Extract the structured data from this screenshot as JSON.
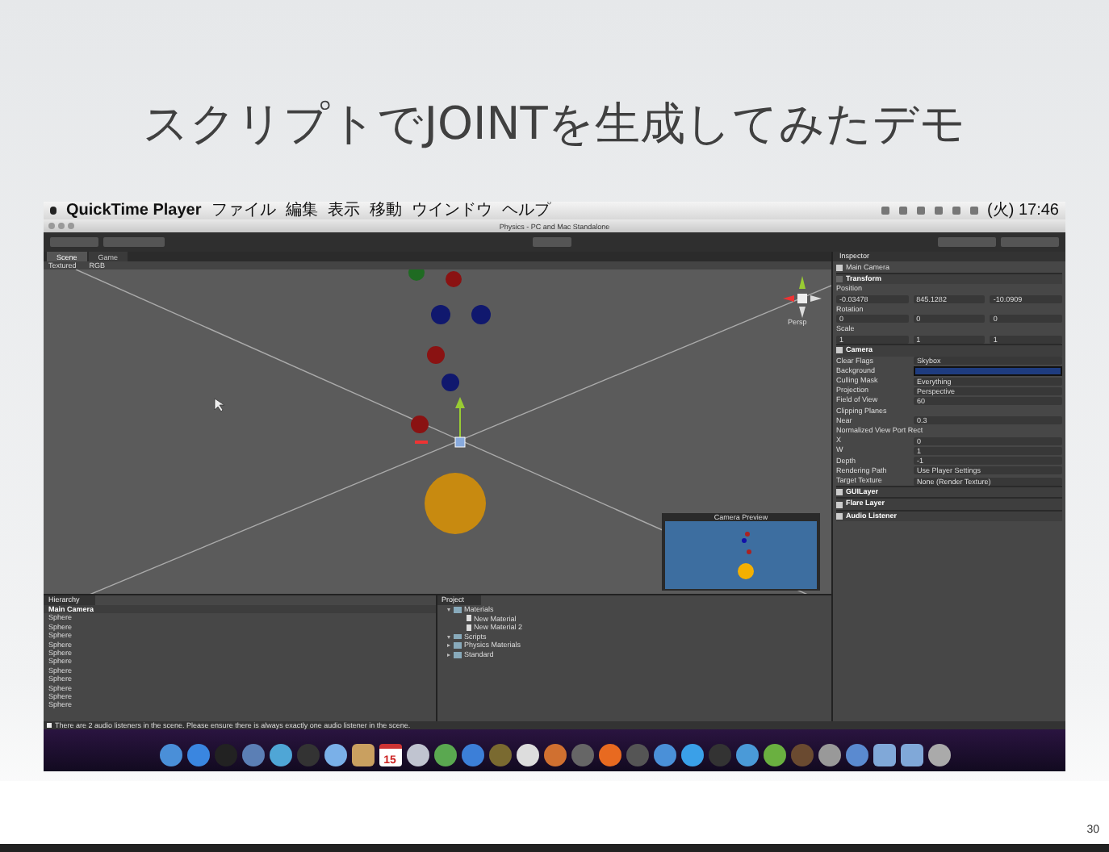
{
  "slide": {
    "title": "スクリプトでJOINTを生成してみたデモ",
    "page_number": "30"
  },
  "menu_bar": {
    "app": "QuickTime Player",
    "items": [
      "ファイル",
      "編集",
      "表示",
      "移動",
      "ウインドウ",
      "ヘルプ"
    ],
    "clock": "(火) 17:46"
  },
  "window": {
    "title": "Physics - PC and Mac Standalone"
  },
  "scene_tabs": [
    {
      "label": "Scene",
      "selected": true
    },
    {
      "label": "Game",
      "selected": false
    }
  ],
  "scene_toolbar": {
    "mode": "Textured",
    "channel": "RGB"
  },
  "scene": {
    "view_label": "Persp",
    "spheres": [
      {
        "color": "#1f6b22"
      },
      {
        "color": "#8a1212"
      },
      {
        "color": "#10186e"
      },
      {
        "color": "#10186e"
      },
      {
        "color": "#8a1212"
      },
      {
        "color": "#10186e"
      },
      {
        "color": "#8a1212"
      },
      {
        "color": "#c88a10"
      }
    ]
  },
  "camera_preview": {
    "title": "Camera Preview"
  },
  "inspector": {
    "title": "Inspector",
    "object": "Main Camera",
    "object_active": true,
    "rows": [
      {
        "kind": "component",
        "label": "Transform",
        "checked": false
      },
      {
        "kind": "section",
        "label": "Position"
      },
      {
        "kind": "vector",
        "values": [
          "-0.03478",
          "845.1282",
          "-10.0909"
        ]
      },
      {
        "kind": "section",
        "label": "Rotation"
      },
      {
        "kind": "vector",
        "values": [
          "0",
          "0",
          "0"
        ]
      },
      {
        "kind": "section",
        "label": "Scale"
      },
      {
        "kind": "vector",
        "values": [
          "1",
          "1",
          "1"
        ]
      },
      {
        "kind": "component",
        "label": "Camera",
        "checked": true
      },
      {
        "kind": "field",
        "label": "Clear Flags",
        "value": "Skybox"
      },
      {
        "kind": "color",
        "label": "Background"
      },
      {
        "kind": "field",
        "label": "Culling Mask",
        "value": "Everything"
      },
      {
        "kind": "field",
        "label": "Projection",
        "value": "Perspective"
      },
      {
        "kind": "field",
        "label": "Field of View",
        "value": "60"
      },
      {
        "kind": "section",
        "label": "Clipping Planes"
      },
      {
        "kind": "field",
        "label": "Near",
        "value": "0.3"
      },
      {
        "kind": "section",
        "label": "Normalized View Port Rect"
      },
      {
        "kind": "field",
        "label": "X",
        "value": "0"
      },
      {
        "kind": "field",
        "label": "W",
        "value": "1"
      },
      {
        "kind": "field",
        "label": "Depth",
        "value": "-1"
      },
      {
        "kind": "field",
        "label": "Rendering Path",
        "value": "Use Player Settings"
      },
      {
        "kind": "field",
        "label": "Target Texture",
        "value": "None (Render Texture)"
      },
      {
        "kind": "component",
        "label": "GUILayer",
        "checked": true
      },
      {
        "kind": "component",
        "label": "Flare Layer",
        "checked": true
      },
      {
        "kind": "component",
        "label": "Audio Listener",
        "checked": true
      }
    ]
  },
  "hierarchy": {
    "title": "Hierarchy",
    "items": [
      {
        "label": "Main Camera",
        "selected": true
      },
      {
        "label": "Sphere",
        "selected": false
      },
      {
        "label": "Sphere",
        "selected": false
      },
      {
        "label": "Sphere",
        "selected": false
      },
      {
        "label": "Sphere",
        "selected": false
      },
      {
        "label": "Sphere",
        "selected": false
      },
      {
        "label": "Sphere",
        "selected": false
      },
      {
        "label": "Sphere",
        "selected": false
      },
      {
        "label": "Sphere",
        "selected": false
      },
      {
        "label": "Sphere",
        "selected": false
      },
      {
        "label": "Sphere",
        "selected": false
      },
      {
        "label": "Sphere",
        "selected": false
      }
    ]
  },
  "project": {
    "title": "Project",
    "items": [
      {
        "label": "Materials",
        "expanded": true,
        "children": [
          {
            "label": "New Material"
          },
          {
            "label": "New Material 2"
          }
        ]
      },
      {
        "label": "Scripts",
        "expanded": true
      },
      {
        "label": "Physics Materials",
        "expanded": false
      },
      {
        "label": "Standard",
        "expanded": false
      }
    ]
  },
  "status_bar": {
    "message": "There are 2 audio listeners in the scene. Please ensure there is always exactly one audio listener in the scene."
  },
  "dock": {
    "calendar_day": "15"
  }
}
